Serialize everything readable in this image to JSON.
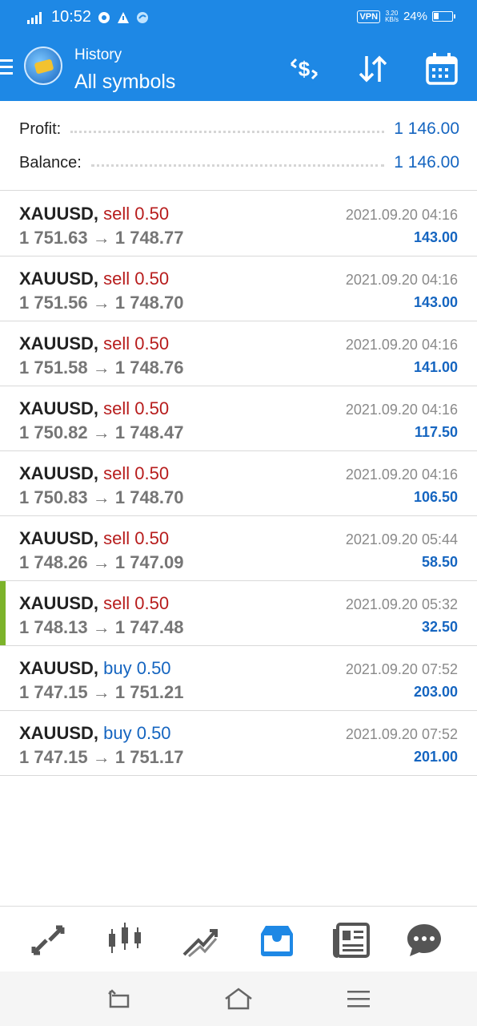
{
  "status_bar": {
    "time": "10:52",
    "vpn": "VPN",
    "net_speed_value": "3.20",
    "net_speed_unit": "KB/s",
    "battery": "24%"
  },
  "header": {
    "title": "History",
    "subtitle": "All symbols"
  },
  "summary": {
    "profit_label": "Profit:",
    "profit_value": "1 146.00",
    "balance_label": "Balance:",
    "balance_value": "1 146.00"
  },
  "trades": [
    {
      "symbol": "XAUUSD,",
      "type": "sell 0.50",
      "direction": "sell",
      "prices": "1 751.63 → 1 748.77",
      "time": "2021.09.20 04:16",
      "profit": "143.00",
      "highlighted": false
    },
    {
      "symbol": "XAUUSD,",
      "type": "sell 0.50",
      "direction": "sell",
      "prices": "1 751.56 → 1 748.70",
      "time": "2021.09.20 04:16",
      "profit": "143.00",
      "highlighted": false
    },
    {
      "symbol": "XAUUSD,",
      "type": "sell 0.50",
      "direction": "sell",
      "prices": "1 751.58 → 1 748.76",
      "time": "2021.09.20 04:16",
      "profit": "141.00",
      "highlighted": false
    },
    {
      "symbol": "XAUUSD,",
      "type": "sell 0.50",
      "direction": "sell",
      "prices": "1 750.82 → 1 748.47",
      "time": "2021.09.20 04:16",
      "profit": "117.50",
      "highlighted": false
    },
    {
      "symbol": "XAUUSD,",
      "type": "sell 0.50",
      "direction": "sell",
      "prices": "1 750.83 → 1 748.70",
      "time": "2021.09.20 04:16",
      "profit": "106.50",
      "highlighted": false
    },
    {
      "symbol": "XAUUSD,",
      "type": "sell 0.50",
      "direction": "sell",
      "prices": "1 748.26 → 1 747.09",
      "time": "2021.09.20 05:44",
      "profit": "58.50",
      "highlighted": false
    },
    {
      "symbol": "XAUUSD,",
      "type": "sell 0.50",
      "direction": "sell",
      "prices": "1 748.13 → 1 747.48",
      "time": "2021.09.20 05:32",
      "profit": "32.50",
      "highlighted": true
    },
    {
      "symbol": "XAUUSD,",
      "type": "buy 0.50",
      "direction": "buy",
      "prices": "1 747.15 → 1 751.21",
      "time": "2021.09.20 07:52",
      "profit": "203.00",
      "highlighted": false
    },
    {
      "symbol": "XAUUSD,",
      "type": "buy 0.50",
      "direction": "buy",
      "prices": "1 747.15 → 1 751.17",
      "time": "2021.09.20 07:52",
      "profit": "201.00",
      "highlighted": false
    }
  ],
  "colors": {
    "accent": "#1e88e5",
    "sell": "#b71c1c",
    "buy": "#1565c0",
    "highlight_marker": "#7cb32a",
    "nav_inactive": "#555555",
    "nav_active": "#1e88e5"
  },
  "icons": {
    "toolbar": [
      "currency-exchange-icon",
      "sort-icon",
      "calendar-icon"
    ],
    "bottom_nav": [
      "quotes-icon",
      "chart-icon",
      "trade-icon",
      "history-icon",
      "news-icon",
      "chat-icon"
    ],
    "bottom_nav_active": "history-icon",
    "system_nav": [
      "back-icon",
      "home-icon",
      "recents-icon"
    ]
  }
}
